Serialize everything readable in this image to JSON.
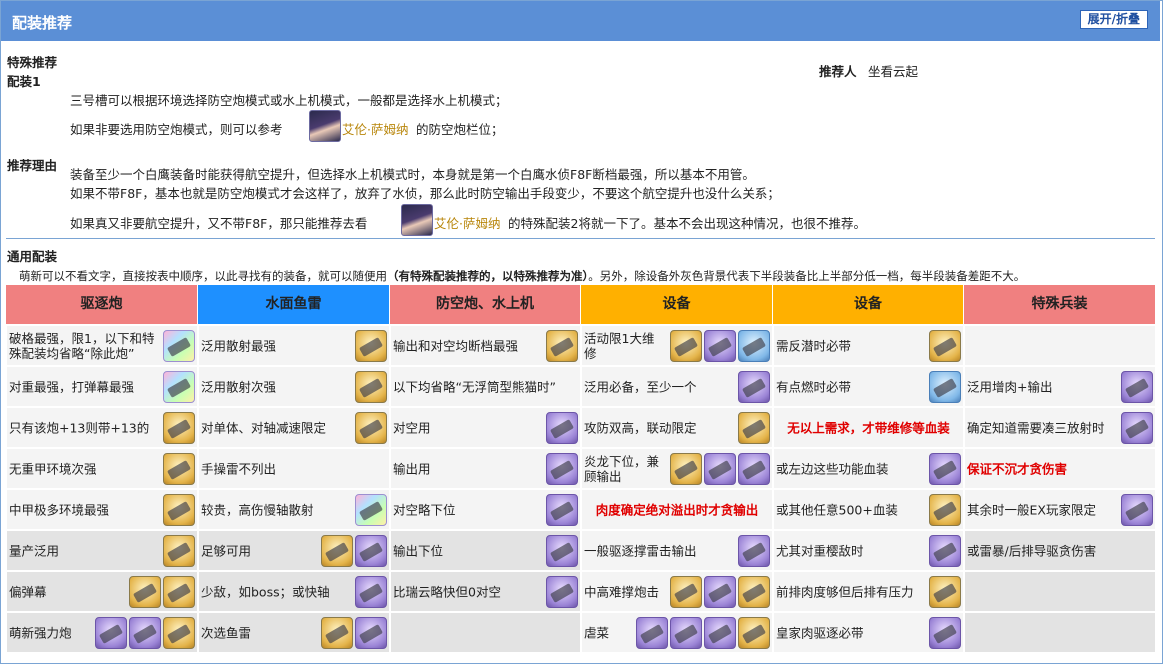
{
  "header": {
    "title": "配装推荐",
    "toggle_label": "展开/折叠"
  },
  "special": {
    "title_line1": "特殊推荐",
    "title_line2": "配装1",
    "recommender_label": "推荐人",
    "recommender_name": "坐看云起",
    "line1": "三号槽可以根据环境选择防空炮模式或水上机模式，一般都是选择水上机模式；",
    "line2_pre": "如果非要选用防空炮模式，则可以参考",
    "line2_link": "艾伦·萨姆纳",
    "line2_post": "的防空炮栏位；",
    "reason_label": "推荐理由",
    "reason1": "装备至少一个白鹰装备时能获得航空提升，但选择水上机模式时，本身就是第一个白鹰水侦F8F断档最强，所以基本不用管。",
    "reason2": "如果不带F8F，基本也就是防空炮模式才会这样了，放弃了水侦，那么此时防空输出手段变少，不要这个航空提升也没什么关系；",
    "reason3_pre": "如果真又非要航空提升，又不带F8F，那只能推荐去看",
    "reason3_link": "艾伦·萨姆纳",
    "reason3_post": "的特殊配装2将就一下了。基本不会出现这种情况，也很不推荐。"
  },
  "general": {
    "title": "通用配装",
    "note_pre": "萌新可以不看文字，直接按表中顺序，以此寻找有的装备，就可以随便用",
    "note_bold": "（有特殊配装推荐的，以特殊推荐为准）",
    "note_post": "。另外，除设备外灰色背景代表下半段装备比上半部分低一档，每半段装备差距不大。",
    "columns": [
      {
        "label": "驱逐炮",
        "color": "#f08080"
      },
      {
        "label": "水面鱼雷",
        "color": "#1e90ff"
      },
      {
        "label": "防空炮、水上机",
        "color": "#f08080"
      },
      {
        "label": "设备",
        "color": "#ffb000"
      },
      {
        "label": "设备",
        "color": "#ffb000"
      },
      {
        "label": "特殊兵装",
        "color": "#f08080"
      }
    ],
    "rows": [
      [
        {
          "text": "破格最强，限1，以下和特殊配装均省略“除此炮”",
          "icons": [
            "rainbow"
          ]
        },
        {
          "text": "泛用散射最强",
          "icons": [
            "gold"
          ]
        },
        {
          "text": "输出和对空均断档最强",
          "icons": [
            "gold"
          ]
        },
        {
          "text": "活动限1大维修",
          "icons": [
            "gold",
            "purple",
            "blue"
          ]
        },
        {
          "text": "需反潜时必带",
          "icons": [
            "gold"
          ]
        },
        {
          "text": "",
          "icons": []
        }
      ],
      [
        {
          "text": "对重最强，打弹幕最强",
          "icons": [
            "rainbow"
          ]
        },
        {
          "text": "泛用散射次强",
          "icons": [
            "gold"
          ]
        },
        {
          "text": "以下均省略“无浮筒型熊猫时”",
          "icons": []
        },
        {
          "text": "泛用必备，至少一个",
          "icons": [
            "purple"
          ]
        },
        {
          "text": "有点燃时必带",
          "icons": [
            "blue"
          ]
        },
        {
          "text": "泛用增肉+输出",
          "icons": [
            "purple"
          ]
        }
      ],
      [
        {
          "text": "只有该炮+13则带+13的",
          "icons": [
            "gold"
          ]
        },
        {
          "text": "对单体、对轴减速限定",
          "icons": [
            "gold"
          ]
        },
        {
          "text": "对空用",
          "icons": [
            "purple"
          ]
        },
        {
          "text": "攻防双高，联动限定",
          "icons": [
            "gold"
          ]
        },
        {
          "text": "无以上需求，才带维修等血装",
          "red": true,
          "icons": []
        },
        {
          "text": "确定知道需要凑三放射时",
          "icons": [
            "purple"
          ]
        }
      ],
      [
        {
          "text": "无重甲环境次强",
          "icons": [
            "gold"
          ]
        },
        {
          "text": "手操雷不列出",
          "icons": []
        },
        {
          "text": "输出用",
          "icons": [
            "purple"
          ]
        },
        {
          "text": "炎龙下位，兼顾输出",
          "icons": [
            "gold",
            "purple",
            "purple"
          ]
        },
        {
          "text": "或左边这些功能血装",
          "icons": [
            "purple"
          ]
        },
        {
          "text": "保证不沉才贪伤害",
          "red": true,
          "left": true,
          "icons": []
        }
      ],
      [
        {
          "text": "中甲极多环境最强",
          "icons": [
            "gold"
          ]
        },
        {
          "text": "较贵，高伤慢轴散射",
          "icons": [
            "rainbow"
          ]
        },
        {
          "text": "对空略下位",
          "icons": [
            "purple"
          ]
        },
        {
          "text": "肉度确定绝对溢出时才贪输出",
          "red": true,
          "icons": []
        },
        {
          "text": "或其他任意500+血装",
          "icons": [
            "gold"
          ]
        },
        {
          "text": "其余时一般EX玩家限定",
          "icons": [
            "purple"
          ]
        }
      ],
      [
        {
          "text": "量产泛用",
          "grey": true,
          "icons": [
            "gold"
          ]
        },
        {
          "text": "足够可用",
          "grey": true,
          "icons": [
            "gold",
            "purple"
          ]
        },
        {
          "text": "输出下位",
          "grey": true,
          "icons": [
            "purple"
          ]
        },
        {
          "text": "一般驱逐撑雷击输出",
          "icons": [
            "purple"
          ]
        },
        {
          "text": "尤其对重樱敌时",
          "icons": [
            "purple"
          ]
        },
        {
          "text": "或雷暴/后排导驱贪伤害",
          "grey": true,
          "icons": []
        }
      ],
      [
        {
          "text": "偏弹幕",
          "grey": true,
          "icons": [
            "gold",
            "gold"
          ]
        },
        {
          "text": "少敌，如boss；或快轴",
          "grey": true,
          "icons": [
            "purple"
          ]
        },
        {
          "text": "比瑞云略快但0对空",
          "grey": true,
          "icons": [
            "purple"
          ]
        },
        {
          "text": "中高难撑炮击",
          "icons": [
            "gold",
            "purple",
            "gold"
          ]
        },
        {
          "text": "前排肉度够但后排有压力",
          "icons": [
            "gold"
          ]
        },
        {
          "text": "",
          "grey": true,
          "icons": []
        }
      ],
      [
        {
          "text": "萌新强力炮",
          "grey": true,
          "icons": [
            "purple",
            "purple",
            "gold"
          ]
        },
        {
          "text": "次选鱼雷",
          "grey": true,
          "icons": [
            "gold",
            "purple"
          ]
        },
        {
          "text": "",
          "grey": true,
          "icons": []
        },
        {
          "text": "虐菜",
          "icons": [
            "purple",
            "purple",
            "purple",
            "gold"
          ]
        },
        {
          "text": "皇家肉驱逐必带",
          "icons": [
            "purple"
          ]
        },
        {
          "text": "",
          "grey": true,
          "icons": []
        }
      ]
    ]
  }
}
